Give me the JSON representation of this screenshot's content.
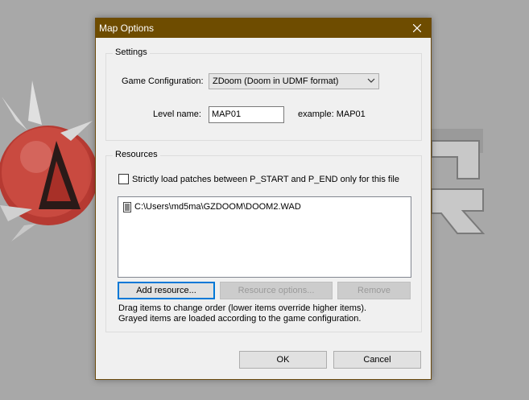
{
  "window": {
    "title": "Map Options"
  },
  "settings": {
    "group_label": "Settings",
    "game_config_label": "Game Configuration:",
    "game_config_value": "ZDoom (Doom in UDMF format)",
    "level_name_label": "Level name:",
    "level_name_value": "MAP01",
    "example_label": "example:  MAP01"
  },
  "resources": {
    "group_label": "Resources",
    "strict_patches_label": "Strictly load patches between P_START and P_END only for this file",
    "strict_patches_checked": false,
    "items": [
      {
        "path": "C:\\Users\\md5ma\\GZDOOM\\DOOM2.WAD",
        "icon": "file-icon"
      }
    ],
    "add_button": "Add resource...",
    "options_button": "Resource options...",
    "remove_button": "Remove",
    "hint_line1": "Drag items to change order (lower items override higher items).",
    "hint_line2": "Grayed items are loaded according to the game configuration."
  },
  "footer": {
    "ok_label": "OK",
    "cancel_label": "Cancel"
  },
  "colors": {
    "titlebar": "#6e4c00",
    "accent": "#0078d7",
    "background": "#a8a8a8"
  }
}
